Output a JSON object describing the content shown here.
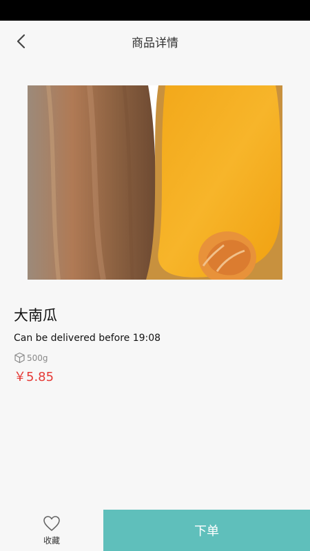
{
  "header": {
    "title": "商品详情",
    "back_icon": "back-chevron-icon"
  },
  "product": {
    "image_name": "pumpkin-image",
    "name": "大南瓜",
    "delivery_text": "Can be delivered before 19:08",
    "weight": "500g",
    "weight_icon": "package-box-icon",
    "price": "￥5.85",
    "price_color": "#e53935"
  },
  "bottom_bar": {
    "favorite_label": "收藏",
    "favorite_icon": "heart-outline-icon",
    "order_label": "下单",
    "order_bg": "#5fbfbb"
  }
}
